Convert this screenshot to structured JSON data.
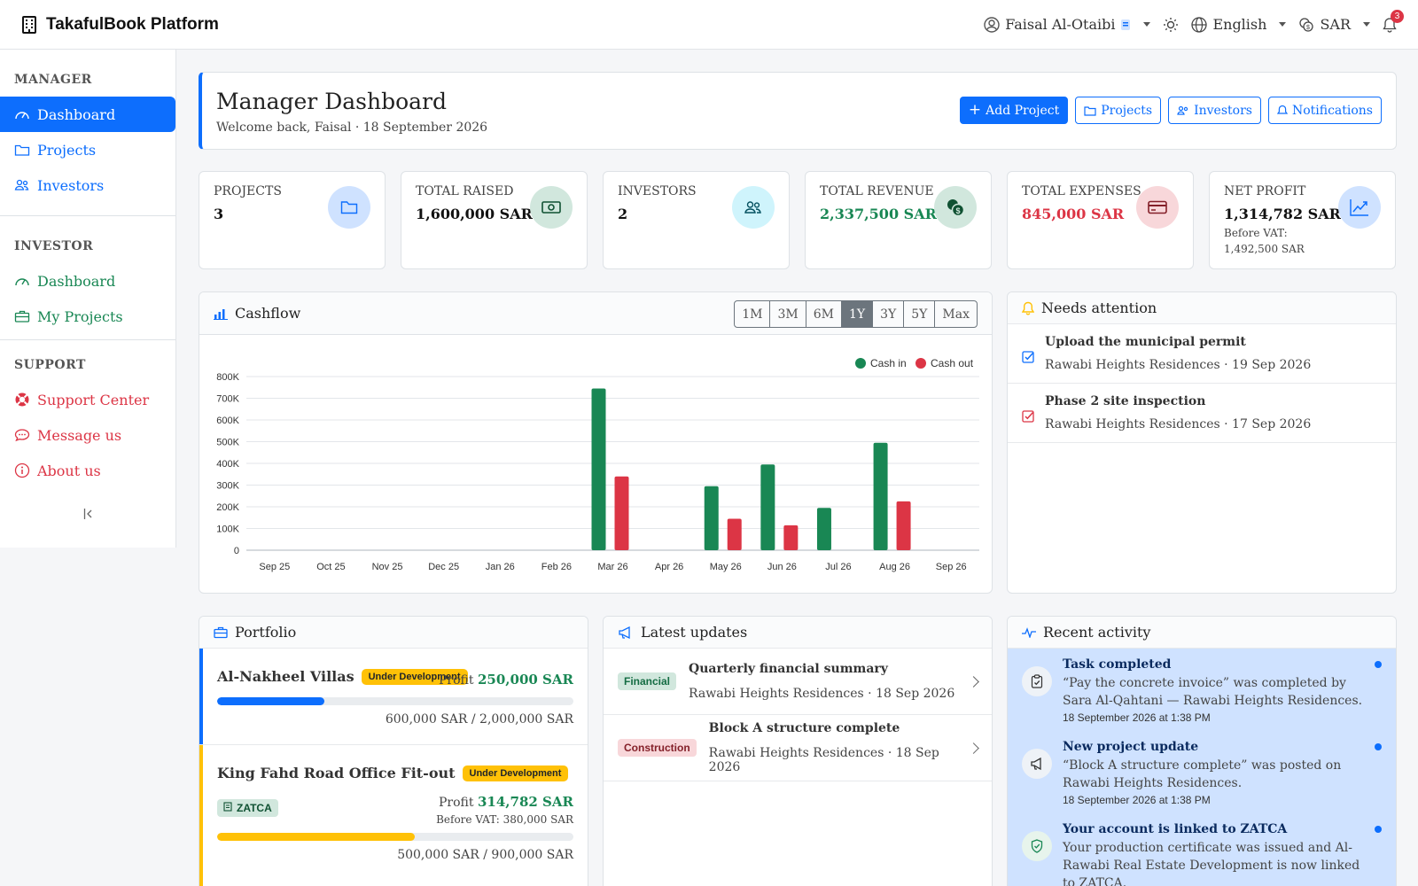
{
  "app": {
    "title": "TakafulBook Platform"
  },
  "topbar": {
    "user": "Faisal Al-Otaibi",
    "language": "English",
    "currency": "SAR",
    "notification_count": "3"
  },
  "sidebar": {
    "sections": [
      {
        "title": "MANAGER",
        "items": [
          {
            "label": "Dashboard"
          },
          {
            "label": "Projects"
          },
          {
            "label": "Investors"
          }
        ]
      },
      {
        "title": "INVESTOR",
        "items": [
          {
            "label": "Dashboard"
          },
          {
            "label": "My Projects"
          }
        ]
      },
      {
        "title": "SUPPORT",
        "items": [
          {
            "label": "Support Center"
          },
          {
            "label": "Message us"
          },
          {
            "label": "About us"
          }
        ]
      }
    ]
  },
  "header": {
    "title": "Manager Dashboard",
    "subtitle": "Welcome back, Faisal · 18 September 2026",
    "buttons": {
      "add_project": "Add Project",
      "projects": "Projects",
      "investors": "Investors",
      "notifications": "Notifications"
    }
  },
  "kpis": [
    {
      "label": "Projects",
      "value": "3",
      "color": "#111111",
      "icon": "folder-icon",
      "tint": "#cfe2ff",
      "stroke": "#0d6efd"
    },
    {
      "label": "Total raised",
      "value": "1,600,000 SAR",
      "color": "#111111",
      "icon": "cash-icon",
      "tint": "#d1e7dd",
      "stroke": "#0f5132"
    },
    {
      "label": "Investors",
      "value": "2",
      "color": "#111111",
      "icon": "people-icon",
      "tint": "#cff4fc",
      "stroke": "#055160"
    },
    {
      "label": "Total revenue",
      "value": "2,337,500 SAR",
      "color": "#198754",
      "icon": "coins-icon",
      "tint": "#d1e7dd",
      "stroke": "#0f5132"
    },
    {
      "label": "Total expenses",
      "value": "845,000 SAR",
      "color": "#dc3545",
      "icon": "credit-card-icon",
      "tint": "#f8d7da",
      "stroke": "#842029"
    },
    {
      "label": "Net profit",
      "value": "1,314,782 SAR",
      "color": "#111111",
      "sub": "Before VAT: 1,492,500 SAR",
      "icon": "trend-icon",
      "tint": "#cfe2ff",
      "stroke": "#0d6efd"
    }
  ],
  "cashflow": {
    "title": "Cashflow",
    "ranges": [
      "1M",
      "3M",
      "6M",
      "1Y",
      "3Y",
      "5Y",
      "Max"
    ],
    "active_range": "1Y"
  },
  "chart_data": {
    "type": "bar",
    "categories": [
      "Sep 25",
      "Oct 25",
      "Nov 25",
      "Dec 25",
      "Jan 26",
      "Feb 26",
      "Mar 26",
      "Apr 26",
      "May 26",
      "Jun 26",
      "Jul 26",
      "Aug 26",
      "Sep 26"
    ],
    "series": [
      {
        "name": "Cash in",
        "color": "#198754",
        "values": [
          0,
          0,
          0,
          0,
          0,
          0,
          745000,
          0,
          295000,
          395000,
          195000,
          495000,
          0
        ]
      },
      {
        "name": "Cash out",
        "color": "#dc3545",
        "values": [
          0,
          0,
          0,
          0,
          0,
          0,
          340000,
          0,
          145000,
          115000,
          0,
          225000,
          0
        ]
      }
    ],
    "yticks": [
      "0",
      "100K",
      "200K",
      "300K",
      "400K",
      "500K",
      "600K",
      "700K",
      "800K"
    ],
    "ylim": [
      0,
      800000
    ],
    "legend": "top-right",
    "grid": true
  },
  "attention": {
    "title": "Needs attention",
    "items": [
      {
        "title": "Upload the municipal permit",
        "meta": "Rawabi Heights Residences · 19 Sep 2026",
        "color": "#0d6efd"
      },
      {
        "title": "Phase 2 site inspection",
        "meta": "Rawabi Heights Residences · 17 Sep 2026",
        "color": "#dc3545"
      }
    ]
  },
  "portfolio": {
    "title": "Portfolio",
    "items": [
      {
        "name": "Al-Nakheel Villas",
        "status": "Under Development",
        "profit_label": "Profit",
        "profit": "250,000 SAR",
        "raised": "600,000 SAR / 2,000,000 SAR",
        "progress": 0.3,
        "color": "#0d6efd"
      },
      {
        "name": "King Fahd Road Office Fit-out",
        "status": "Under Development",
        "badge": "ZATCA",
        "profit_label": "Profit",
        "profit": "314,782 SAR",
        "before_vat": "Before VAT: 380,000 SAR",
        "raised": "500,000 SAR / 900,000 SAR",
        "progress": 0.555,
        "color": "#ffc107"
      }
    ]
  },
  "updates": {
    "title": "Latest updates",
    "items": [
      {
        "tag": "Financial",
        "title": "Quarterly financial summary",
        "meta": "Rawabi Heights Residences · 18 Sep 2026"
      },
      {
        "tag": "Construction",
        "title": "Block A structure complete",
        "meta": "Rawabi Heights Residences · 18 Sep 2026"
      }
    ]
  },
  "activity": {
    "title": "Recent activity",
    "items": [
      {
        "title": "Task completed",
        "body": "“Pay the concrete invoice” was completed by Sara Al-Qahtani — Rawabi Heights Residences.",
        "time": "18 September 2026 at 1:38 PM",
        "icon": "clipboard-check-icon"
      },
      {
        "title": "New project update",
        "body": "“Block A structure complete” was posted on Rawabi Heights Residences.",
        "time": "18 September 2026 at 1:38 PM",
        "icon": "megaphone-icon"
      },
      {
        "title": "Your account is linked to ZATCA",
        "body": "Your production certificate was issued and Al-Rawabi Real Estate Development is now linked to ZATCA.",
        "icon": "shield-check-icon"
      }
    ]
  }
}
